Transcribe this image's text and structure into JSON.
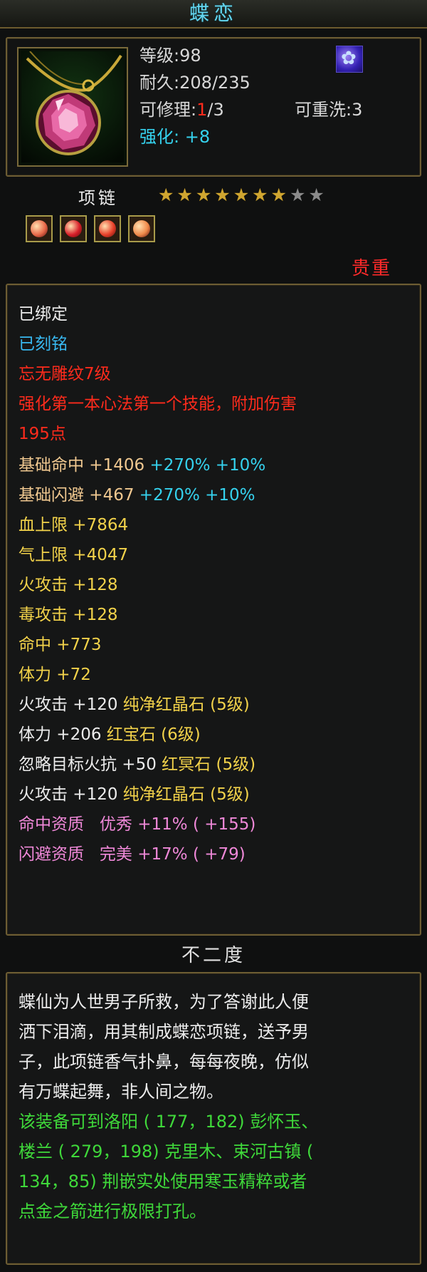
{
  "item": {
    "name": "蝶恋",
    "level_text": "等级:98",
    "durability_text": "耐久:208/235",
    "repair": {
      "label": "可修理:",
      "current": "1",
      "max": "/3"
    },
    "rewash_text": "可重洗:3",
    "enhance_text": "强化: +8",
    "type": "项链",
    "stars": {
      "filled": 7,
      "total": 9
    },
    "slots": [
      "#e86a4a",
      "#d8202a",
      "#e8402a",
      "#f08a4a"
    ],
    "rarity": "贵重"
  },
  "stats": {
    "bound": "已绑定",
    "engraved": "已刻铭",
    "pattern": "忘无雕纹7级",
    "skill_line1": "强化第一本心法第一个技能，附加伤害",
    "skill_line2": "195点",
    "base_hit": {
      "label": "基础命中 +1406",
      "pct1": "+270%",
      "pct2": "+10%"
    },
    "base_dodge": {
      "label": "基础闪避 +467",
      "pct1": "+270%",
      "pct2": "+10%"
    },
    "hp": "血上限 +7864",
    "mp": "气上限 +4047",
    "fire_atk": "火攻击 +128",
    "poison_atk": "毒攻击 +128",
    "hit": "命中 +773",
    "stamina": "体力 +72",
    "gem1": {
      "stat": "火攻击 +120",
      "gem": "纯净红晶石 (5级)"
    },
    "gem2": {
      "stat": "体力 +206",
      "gem": "红宝石 (6级)"
    },
    "gem3": {
      "stat": "忽略目标火抗 +50",
      "gem": "红冥石 (5级)"
    },
    "gem4": {
      "stat": "火攻击 +120",
      "gem": "纯净红晶石 (5级)"
    },
    "quality_hit": "命中资质   优秀 +11% ( +155)",
    "quality_dodge": "闪避资质   完美 +17% ( +79)"
  },
  "set_name": "不二度",
  "description": {
    "lines": [
      "蝶仙为人世男子所救，为了答谢此人便",
      "洒下泪滴，用其制成蝶恋项链，送予男",
      "子，此项链香气扑鼻，每每夜晚，仿似",
      "有万蝶起舞，非人间之物。"
    ],
    "hint_lines": [
      "该装备可到洛阳 ( 177，182) 彭怀玉、",
      "楼兰 ( 279，198) 克里木、束河古镇 (",
      "134，85) 荆嵌实处使用寒玉精粹或者",
      "点金之箭进行极限打孔。"
    ]
  }
}
